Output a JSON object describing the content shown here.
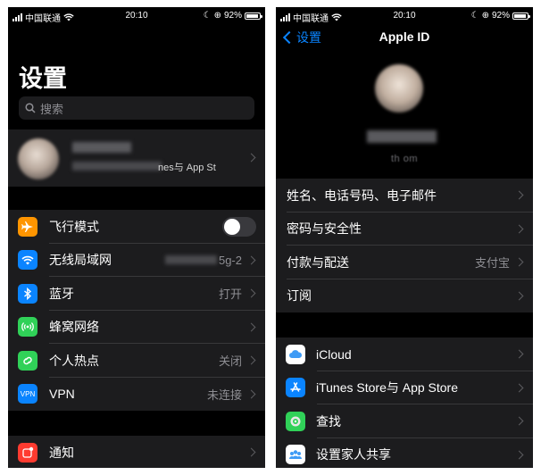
{
  "left": {
    "status": {
      "carrier": "中国联通",
      "time": "20:10",
      "battery": "92%"
    },
    "title": "设置",
    "search": {
      "placeholder": "搜索"
    },
    "profile": {
      "subtitle": "nes与 App St"
    },
    "group1": [
      {
        "label": "飞行模式",
        "icon": "airplane-icon",
        "color": "#ff9500",
        "toggle": false
      },
      {
        "label": "无线局域网",
        "icon": "wifi-icon",
        "color": "#0a84ff",
        "value": "5g-2"
      },
      {
        "label": "蓝牙",
        "icon": "bluetooth-icon",
        "color": "#0a84ff",
        "value": "打开"
      },
      {
        "label": "蜂窝网络",
        "icon": "cellular-icon",
        "color": "#30d158",
        "value": ""
      },
      {
        "label": "个人热点",
        "icon": "hotspot-icon",
        "color": "#30d158",
        "value": "关闭"
      },
      {
        "label": "VPN",
        "icon": "vpn-icon",
        "color": "#0a84ff",
        "value": "未连接",
        "icon_text": "VPN"
      }
    ],
    "group2": [
      {
        "label": "通知",
        "icon": "notification-icon",
        "color": "#ff3b30"
      }
    ]
  },
  "right": {
    "status": {
      "carrier": "中国联通",
      "time": "20:10",
      "battery": "92%"
    },
    "back_label": "设置",
    "nav_title": "Apple ID",
    "email_partial": "th                         om",
    "group1": [
      {
        "label": "姓名、电话号码、电子邮件",
        "value": ""
      },
      {
        "label": "密码与安全性",
        "value": ""
      },
      {
        "label": "付款与配送",
        "value": "支付宝"
      },
      {
        "label": "订阅",
        "value": ""
      }
    ],
    "group2": [
      {
        "label": "iCloud",
        "icon": "icloud-icon",
        "color": "#ffffff"
      },
      {
        "label": "iTunes Store与 App Store",
        "icon": "app-store-icon",
        "color": "#0a84ff"
      },
      {
        "label": "查找",
        "icon": "find-my-icon",
        "color": "#30d158"
      },
      {
        "label": "设置家人共享",
        "icon": "family-sharing-icon",
        "color": "#ffffff"
      }
    ]
  }
}
